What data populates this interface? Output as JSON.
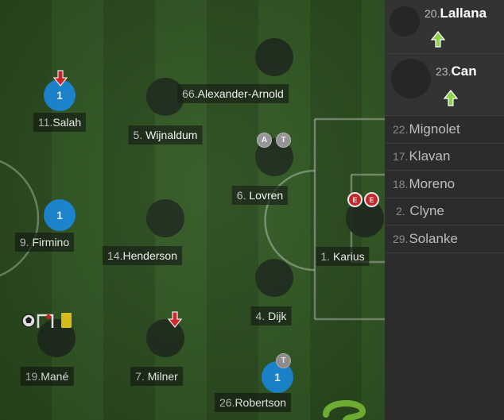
{
  "colors": {
    "rating": "#1a8fe0",
    "sub_out": "#e0252b",
    "sub_in": "#8fd14a",
    "yellow_card": "#f2d21c",
    "badge": "#9a9a9a"
  },
  "players": [
    {
      "id": "salah",
      "number": "11.",
      "name": "Salah",
      "rating": "1",
      "events": [
        "sub-out-arrow"
      ]
    },
    {
      "id": "wijnaldum",
      "number": "5.",
      "name": "Wijnaldum"
    },
    {
      "id": "alexander-arnold",
      "number": "66.",
      "name": "Alexander-Arnold"
    },
    {
      "id": "lovren",
      "number": "6.",
      "name": "Lovren",
      "badges": [
        "A",
        "T"
      ]
    },
    {
      "id": "firmino",
      "number": "9.",
      "name": "Firmino",
      "rating": "1"
    },
    {
      "id": "henderson",
      "number": "14.",
      "name": "Henderson"
    },
    {
      "id": "karius",
      "number": "1.",
      "name": "Karius",
      "badges": [
        "E",
        "E"
      ]
    },
    {
      "id": "dijk",
      "number": "4.",
      "name": "Dijk"
    },
    {
      "id": "mane",
      "number": "19.",
      "name": "Mané",
      "events": [
        "ball-icon",
        "woodwork-icon",
        "yellow-card"
      ]
    },
    {
      "id": "milner",
      "number": "7.",
      "name": "Milner",
      "events": [
        "sub-out-arrow"
      ]
    },
    {
      "id": "robertson",
      "number": "26.",
      "name": "Robertson",
      "rating": "1",
      "badges": [
        "T"
      ]
    }
  ],
  "bench": {
    "subs_in": [
      {
        "number": "20.",
        "name": "Lallana"
      },
      {
        "number": "23.",
        "name": "Can"
      }
    ],
    "unused": [
      {
        "number": "22.",
        "name": "Mignolet"
      },
      {
        "number": "17.",
        "name": "Klavan"
      },
      {
        "number": "18.",
        "name": "Moreno"
      },
      {
        "number": "2.",
        "name": "Clyne"
      },
      {
        "number": "29.",
        "name": "Solanke"
      }
    ]
  }
}
